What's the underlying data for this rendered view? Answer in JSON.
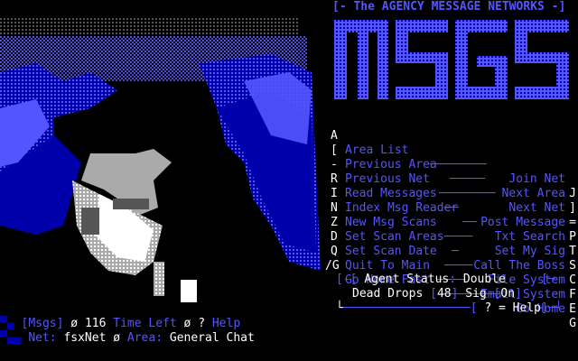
{
  "header": {
    "banner": "The AGENCY MESSAGE NETWORKS",
    "logo_text": "MSGS"
  },
  "menu": {
    "items": [
      {
        "key": "A",
        "left": "Area List",
        "right": "Join Net",
        "rkey": "J"
      },
      {
        "key": "[",
        "left": "Previous Area",
        "right": "Next Area",
        "rkey": "]"
      },
      {
        "key": "-",
        "left": "Previous Net",
        "right": "Next Net",
        "rkey": "="
      },
      {
        "key": "R",
        "left": "Read Messages",
        "right": "Post Message",
        "rkey": "P"
      },
      {
        "key": "I",
        "left": "Index Msg Reader",
        "right": "Txt Search",
        "rkey": "T"
      },
      {
        "key": "N",
        "left": "New Msg Scans",
        "right": "Set My Sig",
        "rkey": "S"
      },
      {
        "key": "Z",
        "left": "Set Scan Areas",
        "right": "Call The Boss",
        "rkey": "C"
      },
      {
        "key": "D",
        "left": "Set Scan Date",
        "right": "File System",
        "rkey": "F"
      },
      {
        "key": "Q",
        "left": "Quit To Main",
        "right": "Email System",
        "rkey": "E"
      },
      {
        "key": "/G",
        "left": "Go Home Fast",
        "right": "Go Home",
        "rkey": "G"
      }
    ]
  },
  "status": {
    "agent_label": "Agent Status",
    "agent_value": "Double",
    "dead_drops_label": "Dead Drops",
    "dead_drops_value": "48",
    "sig_label": "Sig",
    "sig_value": "On",
    "help": "? = Help"
  },
  "footer": {
    "msgs_label": "Msgs",
    "msgs_count": "116",
    "time_left_label": "Time Left",
    "time_left_value": "?",
    "help_label": "Help",
    "net_label": "Net",
    "net_value": "fsxNet",
    "area_label": "Area",
    "area_value": "General Chat"
  },
  "colors": {
    "background": "#000000",
    "bright_blue": "#5555ff",
    "dark_blue": "#0000aa",
    "white": "#ffffff",
    "gray": "#aaaaaa"
  }
}
